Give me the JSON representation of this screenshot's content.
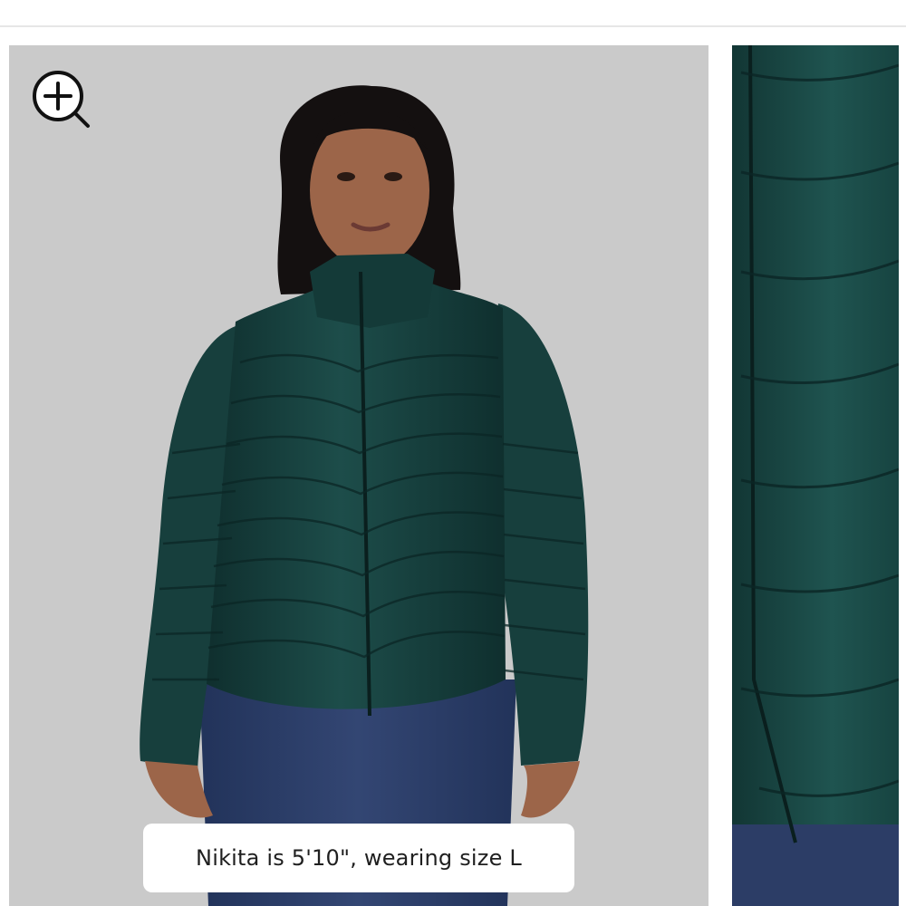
{
  "gallery": {
    "zoom_button": {
      "icon": "zoom-in-icon"
    },
    "main_image": {
      "alt": "Woman wearing a dark green quilted puffer jacket"
    },
    "peek_image": {
      "alt": "Close-up of dark green quilted puffer jacket"
    },
    "caption": "Nikita is 5'10\", wearing size L"
  },
  "colors": {
    "background": "#cacaca",
    "jacket": "#163f3d",
    "jeans": "#2c3d66",
    "caption_bg": "#ffffff"
  }
}
